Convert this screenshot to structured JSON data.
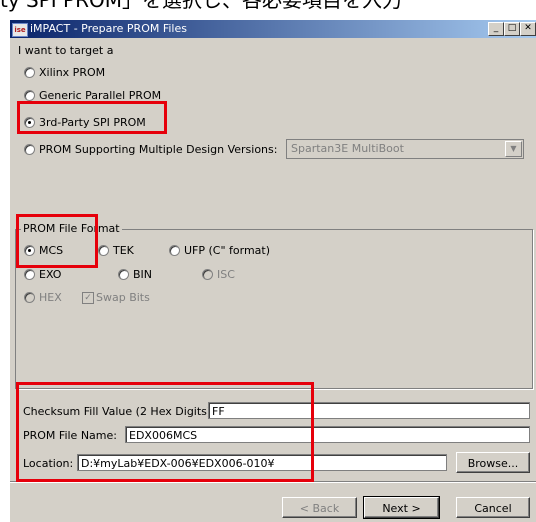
{
  "caption": "ty SPI PROM」を選択し、各必要項目を入力",
  "window": {
    "title": "iMPACT - Prepare PROM Files",
    "app_icon_text": "ise",
    "min_glyph": "_",
    "max_glyph": "□",
    "close_glyph": "✕"
  },
  "target": {
    "heading": "I want to target a",
    "options": [
      {
        "label": "Xilinx PROM",
        "checked": false
      },
      {
        "label": "Generic Parallel PROM",
        "checked": false
      },
      {
        "label": "3rd-Party SPI PROM",
        "checked": true
      },
      {
        "label": "PROM Supporting Multiple Design Versions:",
        "checked": false
      }
    ],
    "multiboot_select": {
      "value": "Spartan3E MultiBoot",
      "enabled": false
    }
  },
  "format": {
    "group_title": "PROM File Format",
    "options": [
      {
        "label": "MCS",
        "checked": true,
        "enabled": true
      },
      {
        "label": "TEK",
        "checked": false,
        "enabled": true
      },
      {
        "label": "UFP (C\" format)",
        "checked": false,
        "enabled": true
      },
      {
        "label": "EXO",
        "checked": false,
        "enabled": true
      },
      {
        "label": "BIN",
        "checked": false,
        "enabled": true
      },
      {
        "label": "ISC",
        "checked": false,
        "enabled": false
      },
      {
        "label": "HEX",
        "checked": false,
        "enabled": false
      }
    ],
    "swap_bits": {
      "label": "Swap Bits",
      "checked": true,
      "enabled": false
    }
  },
  "fields": {
    "checksum_label": "Checksum Fill Value (2 Hex Digits):",
    "checksum_value": "FF",
    "filename_label": "PROM File Name:",
    "filename_value": "EDX006MCS",
    "location_label": "Location:",
    "location_value": "D:¥myLab¥EDX-006¥EDX006-010¥",
    "browse_label": "Browse..."
  },
  "buttons": {
    "back": "< Back",
    "next": "Next >",
    "cancel": "Cancel"
  },
  "highlight_color": "#e6000b"
}
